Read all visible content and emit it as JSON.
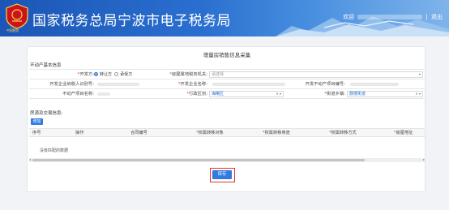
{
  "header": {
    "site_title": "国家税务总局宁波市电子税务局",
    "logo_caption": "中国税务",
    "welcome": "欢迎",
    "logout": "退出",
    "separator": "|"
  },
  "form": {
    "title": "增量房销售信息采集",
    "section_basic": "不动产基本信息",
    "fields": {
      "developer_label": "开发方:",
      "developer_options": [
        "转让方",
        "承受方"
      ],
      "tax_authority_label": "房屋属地税务机关:",
      "tax_authority_placeholder": "请选择",
      "dev_taxid_label": "开发企业纳税人识别号:",
      "dev_name_label": "开发企业名称:",
      "dev_project_no_label": "开发不动产项目编号:",
      "project_name_label": "不动产项目名称:",
      "district_label": "行政区划:",
      "district_value": "海曙区",
      "street_label": "街道乡镇:",
      "street_value": "鼓楼街道"
    },
    "section_deal": "房源及交易信息:",
    "add_button": "增加",
    "table_headers": [
      "序号",
      "操作",
      "合同编号",
      "权属转移对象",
      "权属转移用途",
      "权属转移方式",
      "房屋地址"
    ],
    "table_required": [
      false,
      false,
      false,
      true,
      true,
      true,
      true
    ],
    "empty_text": "没有匹配的数据",
    "save_button": "保存"
  }
}
